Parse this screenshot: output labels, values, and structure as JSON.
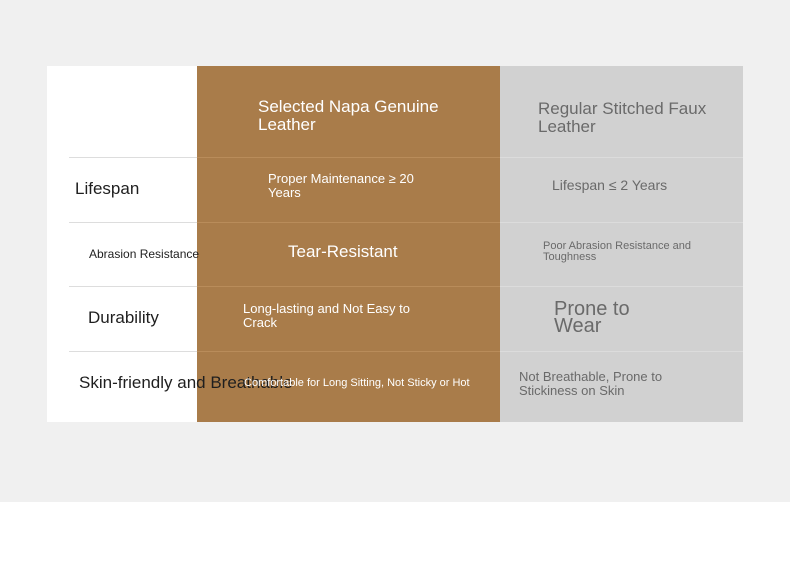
{
  "header": {
    "genuine_leather": "Selected Napa Genuine Leather",
    "faux_leather": "Regular Stitched Faux Leather"
  },
  "rows": [
    {
      "label": "Lifespan",
      "genuine": "Proper Maintenance ≥ 20 Years",
      "faux": "Lifespan ≤ 2 Years"
    },
    {
      "label": "Abrasion Resistance",
      "genuine": "Tear-Resistant",
      "faux": "Poor Abrasion Resistance and Toughness"
    },
    {
      "label": "Durability",
      "genuine": "Long-lasting and Not Easy to Crack",
      "faux": "Prone to Wear"
    },
    {
      "label": "Skin-friendly and Breathable",
      "genuine": "Comfortable for Long Sitting, Not Sticky or Hot",
      "faux": "Not Breathable, Prone to Stickiness on Skin"
    }
  ],
  "colors": {
    "genuine_column": "#a97c4a",
    "faux_column": "#d1d1d1",
    "page_background": "#f0f0f0"
  }
}
